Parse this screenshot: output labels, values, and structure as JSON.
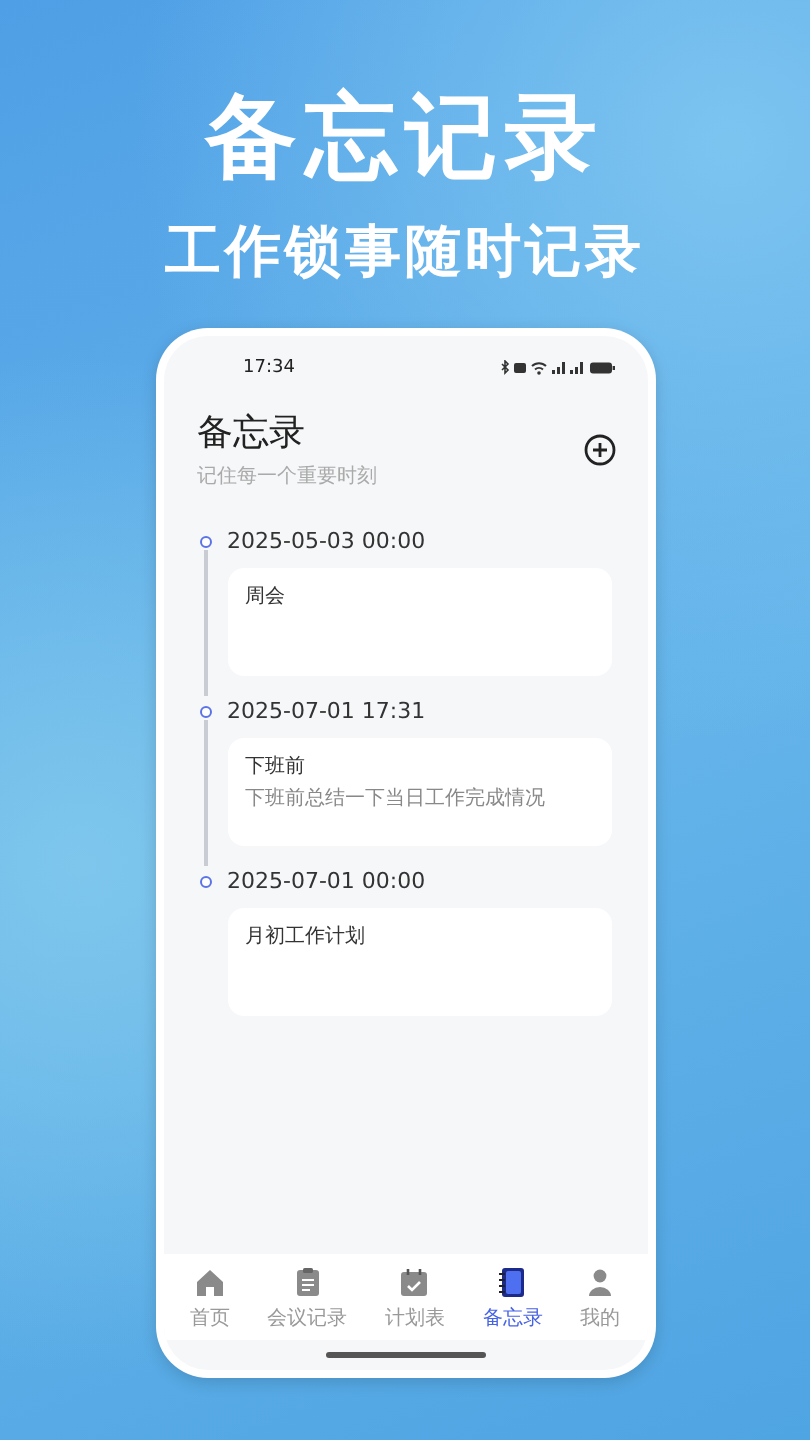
{
  "hero": {
    "title": "备忘记录",
    "subtitle": "工作锁事随时记录"
  },
  "status_bar": {
    "time": "17:34"
  },
  "header": {
    "title": "备忘录",
    "subtitle": "记住每一个重要时刻"
  },
  "entries": [
    {
      "time": "2025-05-03 00:00",
      "title": "周会"
    },
    {
      "time": "2025-07-01 17:31",
      "title": "下班前",
      "note": "下班前总结一下当日工作完成情况"
    },
    {
      "time": "2025-07-01 00:00",
      "title": "月初工作计划"
    }
  ],
  "tabs": [
    {
      "label": "首页",
      "selected": false
    },
    {
      "label": "会议记录",
      "selected": false
    },
    {
      "label": "计划表",
      "selected": false
    },
    {
      "label": "备忘录",
      "selected": true
    },
    {
      "label": "我的",
      "selected": false
    }
  ]
}
